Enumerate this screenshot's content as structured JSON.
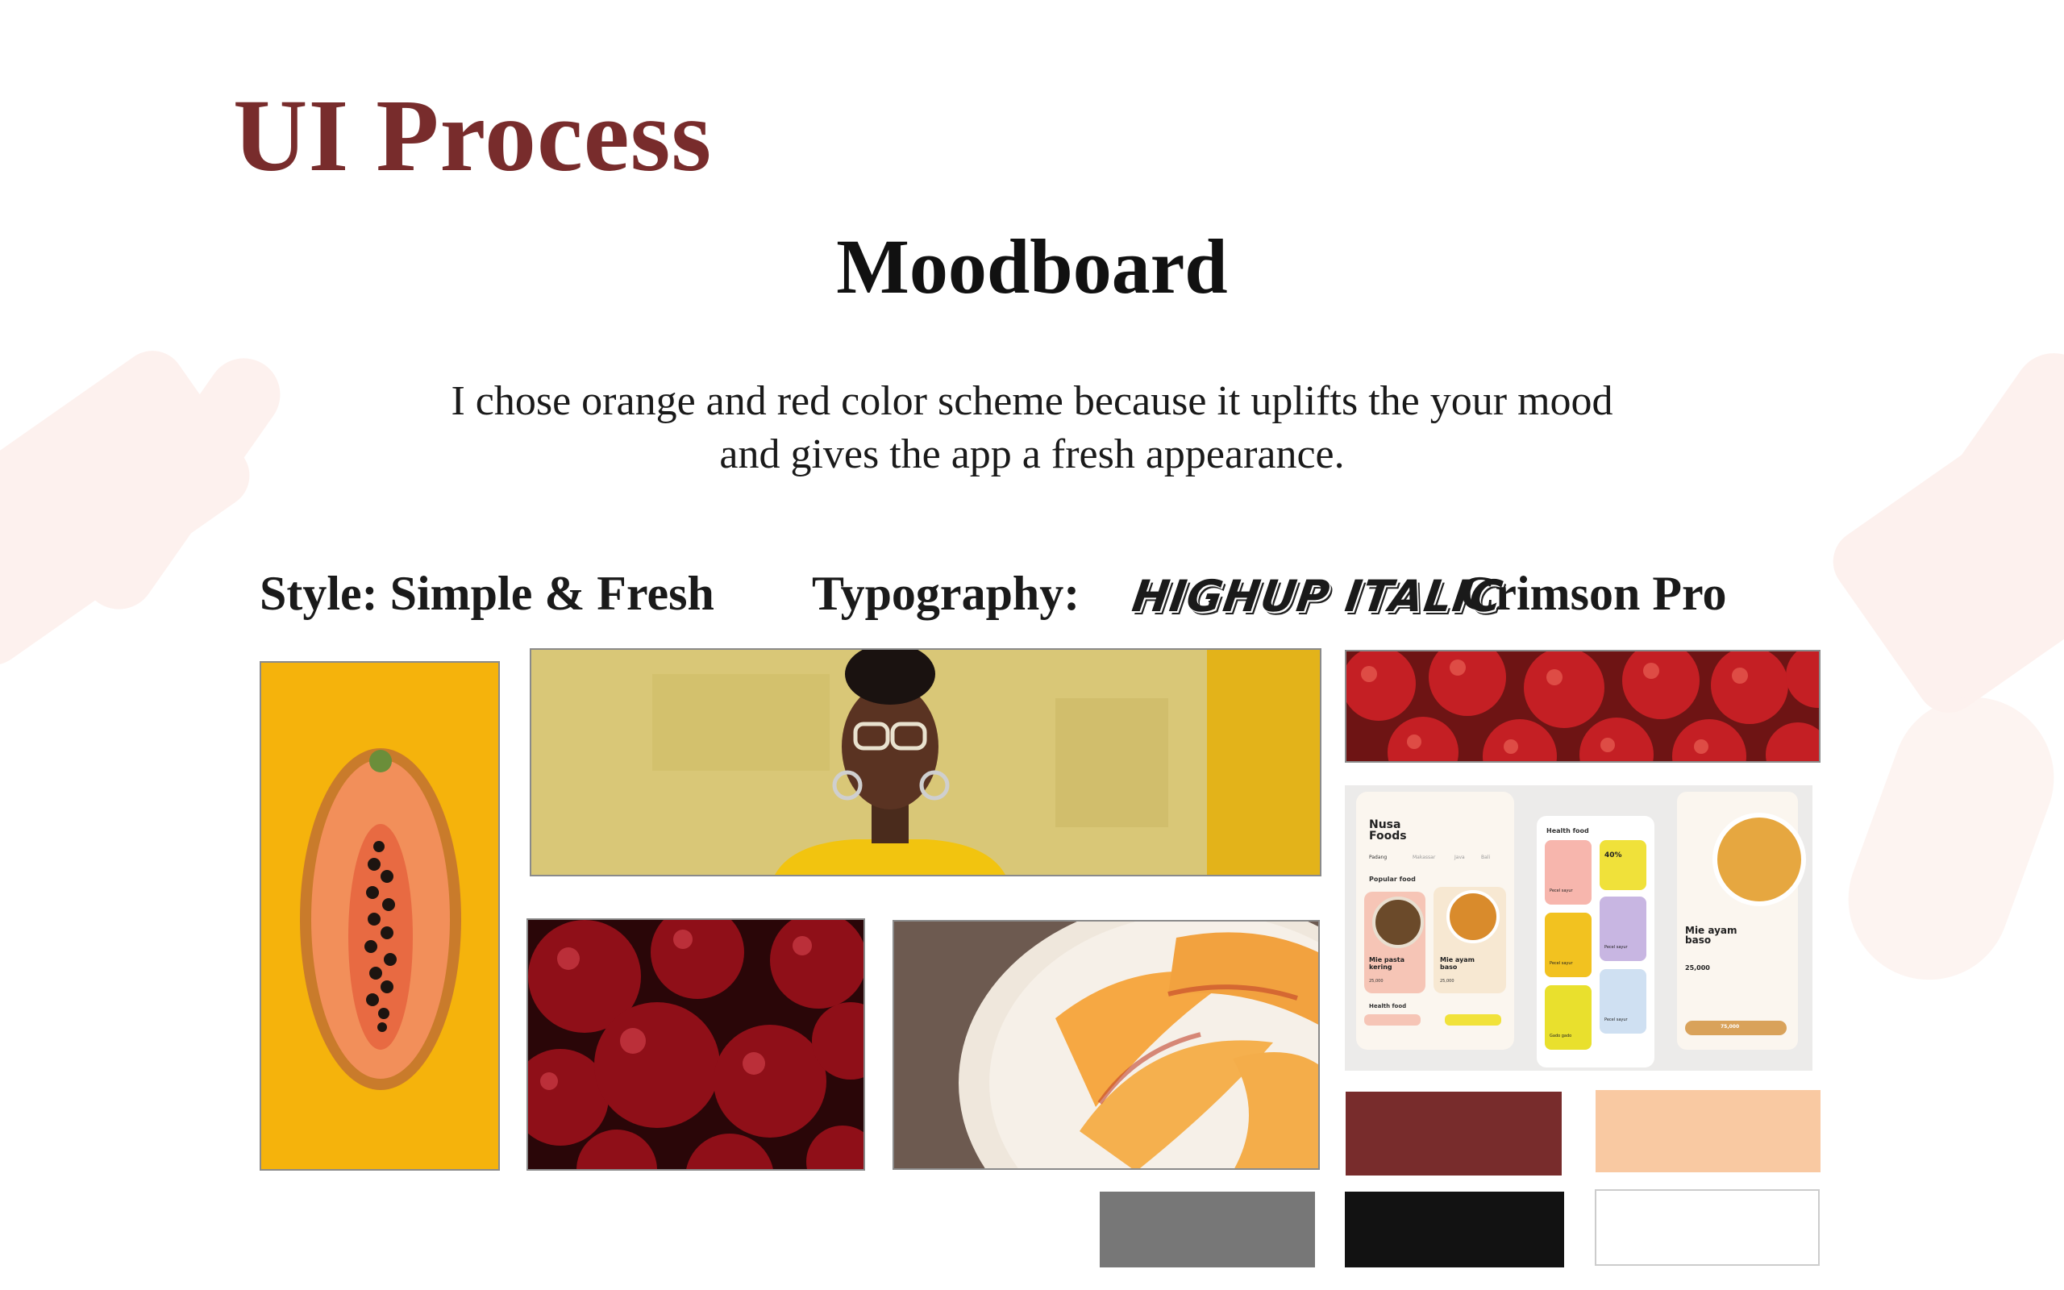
{
  "header": {
    "title": "UI Process",
    "subtitle": "Moodboard",
    "description_line1": "I chose orange and red color scheme because it uplifts the your mood",
    "description_line2": "and gives the app a fresh appearance."
  },
  "style_row": {
    "style_label": "Style: Simple & Fresh",
    "typography_label": "Typography:",
    "font_display": "HIGHUP ITALIC",
    "font_body": "Crimson Pro"
  },
  "app_mockup": {
    "brand": "Nusa Foods",
    "tabs": [
      "Padang",
      "Makassar",
      "Java",
      "Bali"
    ],
    "popular_label": "Popular food",
    "health_label": "Health food",
    "card1_name": "Mie pasta kering",
    "card1_price": "25,000",
    "card2_name": "Mie ayam baso",
    "card2_price": "25,000",
    "promo": "40%",
    "detail_name": "Mie ayam baso",
    "detail_price": "25,000",
    "detail_button": "75,000",
    "small_items": [
      "Pecel sayur",
      "Pecel sayur",
      "Pecel sayur",
      "Pecel sayur",
      "Pecel sayur",
      "Gado gado"
    ]
  },
  "palette": {
    "colors": [
      "#782c2c",
      "#f9c9a2",
      "#777777",
      "#121212",
      "#ffffff"
    ]
  },
  "icons": [
    "spoon-watermark-icon",
    "ladle-watermark-icon"
  ]
}
